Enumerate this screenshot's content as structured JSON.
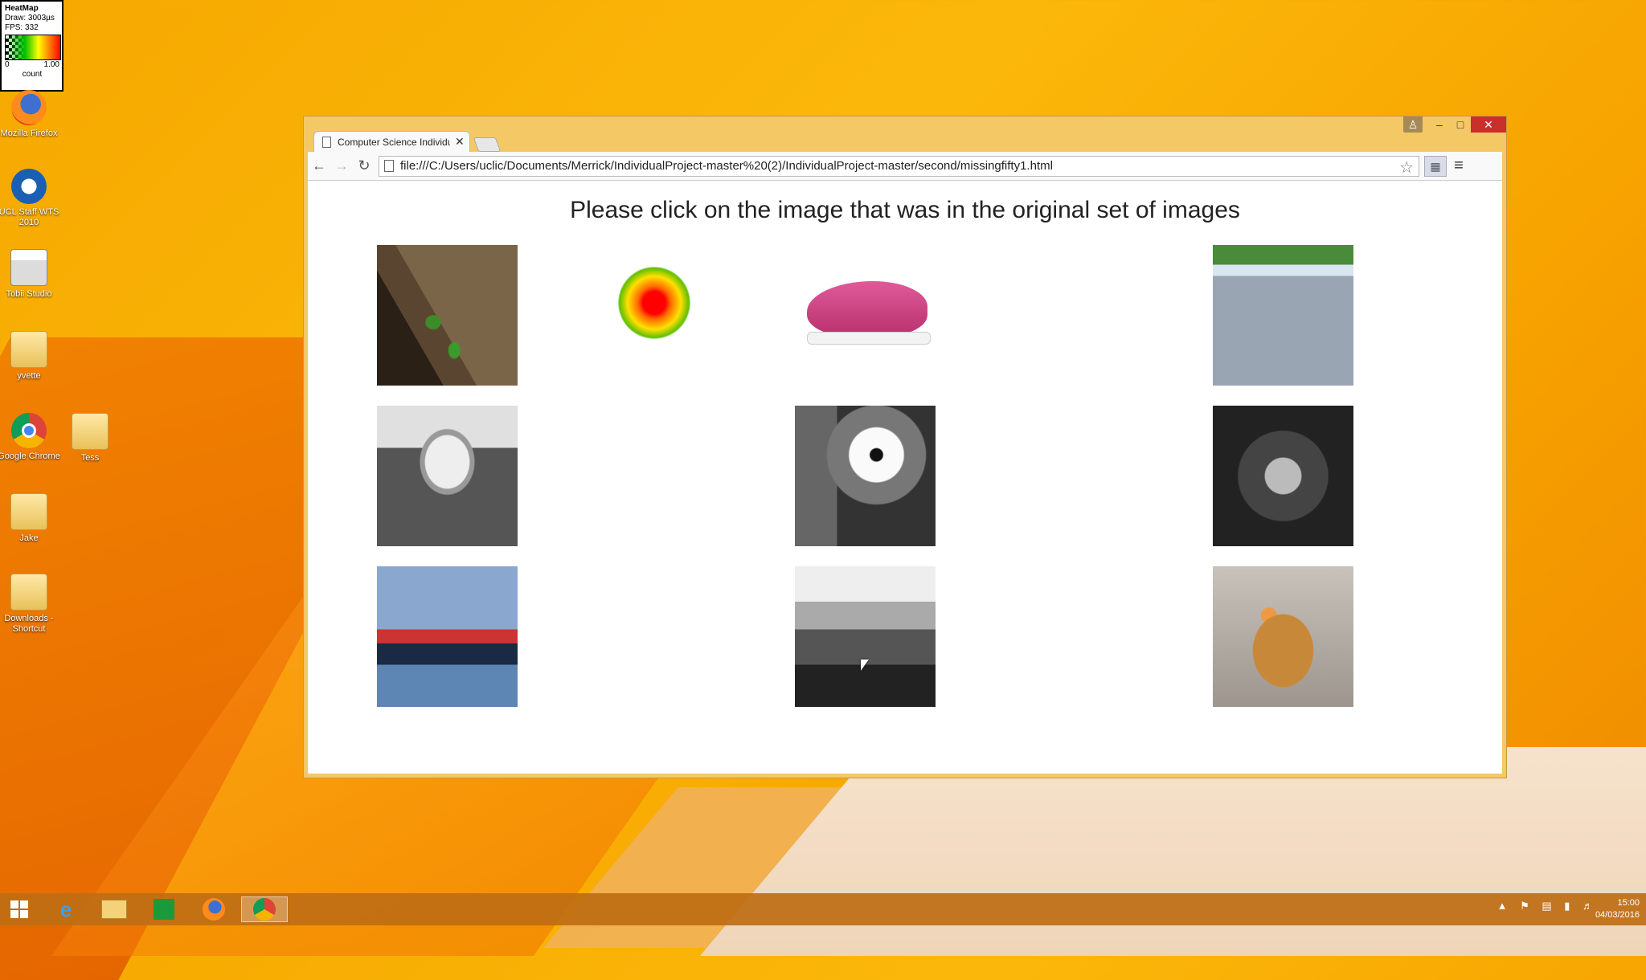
{
  "heatmap": {
    "title": "HeatMap",
    "draw": "Draw: 3003µs",
    "fps": "FPS: 332",
    "min": "0",
    "max": "1.00",
    "unit": "count"
  },
  "desktop": {
    "icons": [
      {
        "label": "Mozilla Firefox",
        "icon": "firefox-icon"
      },
      {
        "label": "UCL Staff WTS 2010",
        "icon": "ucl-icon"
      },
      {
        "label": "Tobii Studio",
        "icon": "tobii-icon"
      },
      {
        "label": "yvette",
        "icon": "folder-icon"
      },
      {
        "label": "Google Chrome",
        "icon": "chrome-icon"
      },
      {
        "label": "Tess",
        "icon": "folder-icon"
      },
      {
        "label": "Jake",
        "icon": "folder-icon"
      },
      {
        "label": "Downloads - Shortcut",
        "icon": "folder-icon"
      }
    ]
  },
  "browser": {
    "tab_title": "Computer Science Individu",
    "url": "file:///C:/Users/uclic/Documents/Merrick/IndividualProject-master%20(2)/IndividualProject-master/second/missingfifty1.html",
    "prompt": "Please click on the image that was in the original set of images",
    "images": [
      {
        "name": "image-frogs",
        "subject": "green frogs on bark"
      },
      {
        "name": "image-shoe",
        "subject": "pink running shoe"
      },
      {
        "name": "image-go-karts",
        "subject": "go-kart race"
      },
      {
        "name": "image-las-vegas",
        "subject": "Welcome to Las Vegas sign"
      },
      {
        "name": "image-lemur",
        "subject": "lemur"
      },
      {
        "name": "image-tulip",
        "subject": "tulip with water drops"
      },
      {
        "name": "image-ship",
        "subject": "cargo ship"
      },
      {
        "name": "image-lake",
        "subject": "lake view from balcony"
      },
      {
        "name": "image-gingerbread-house",
        "subject": "gingerbread house"
      }
    ]
  },
  "taskbar": {
    "clock_time": "15:00",
    "clock_date": "04/03/2016"
  },
  "colors": {
    "desktop": "#f6a800",
    "close_button": "#c9302c",
    "taskbar": "#be6e14"
  }
}
